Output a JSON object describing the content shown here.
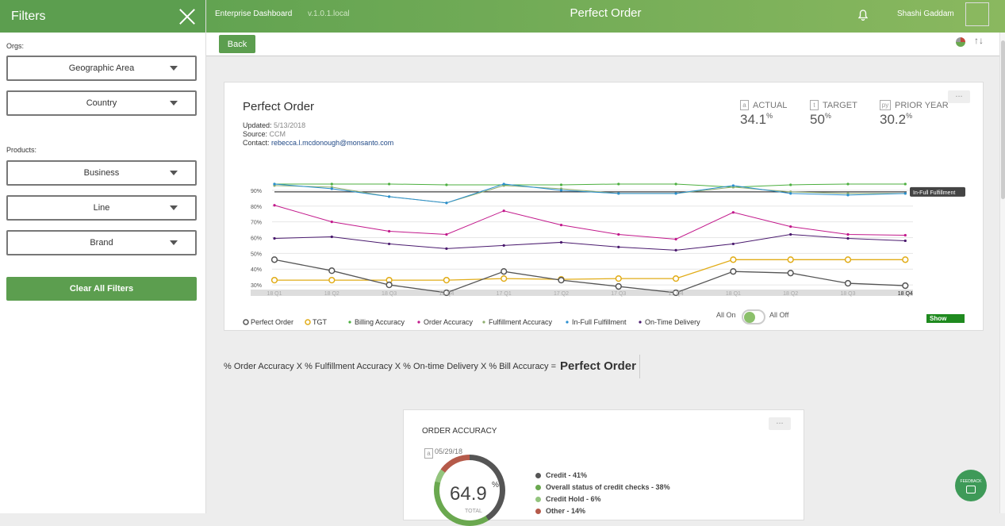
{
  "sidebar": {
    "title": "Filters",
    "orgs_label": "Orgs:",
    "products_label": "Products:",
    "orgs": [
      "Geographic Area",
      "Country"
    ],
    "products": [
      "Business",
      "Line",
      "Brand"
    ],
    "clear_label": "Clear All Filters"
  },
  "topbar": {
    "app_name": "Enterprise Dashboard",
    "version": "v.1.0.1.local",
    "title": "Perfect Order",
    "user": "Shashi Gaddam"
  },
  "subbar": {
    "back_label": "Back",
    "sort_icon": "↑↓"
  },
  "card": {
    "title": "Perfect Order",
    "updated_label": "Updated:",
    "updated": "5/13/2018",
    "source_label": "Source:",
    "source": "CCM",
    "contact_label": "Contact:",
    "contact": "rebecca.l.mcdonough@monsanto.com",
    "more": "...",
    "kpis": [
      {
        "icon": "a",
        "label": "ACTUAL",
        "value": "34.1",
        "unit": "%"
      },
      {
        "icon": "t",
        "label": "TARGET",
        "value": "50",
        "unit": "%"
      },
      {
        "icon": "py",
        "label": "PRIOR YEAR",
        "value": "30.2",
        "unit": "%"
      }
    ],
    "legend": [
      {
        "label": "Perfect Order",
        "symbol": "ring",
        "color": "#555555"
      },
      {
        "label": "TGT",
        "symbol": "ring",
        "color": "#e1ac17"
      },
      {
        "label": "Billing Accuracy",
        "symbol": "dot",
        "color": "#4caf3f"
      },
      {
        "label": "Order Accuracy",
        "symbol": "dot",
        "color": "#c2188b"
      },
      {
        "label": "Fulfillment Accuracy",
        "symbol": "dot",
        "color": "#8fae6f"
      },
      {
        "label": "In-Full Fulfillment",
        "symbol": "dot",
        "color": "#2a8fd0"
      },
      {
        "label": "On-Time Delivery",
        "symbol": "dot",
        "color": "#4a1a6e"
      }
    ],
    "toggle_on": "All On",
    "toggle_off": "All Off",
    "show_values": "Show Values"
  },
  "chart_data": {
    "type": "line",
    "categories": [
      "18 Q1",
      "18 Q2",
      "18 Q3",
      "18 Q4",
      "17 Q1",
      "17 Q2",
      "17 Q3",
      "17 Q4",
      "18 Q1",
      "18 Q2",
      "18 Q3",
      "18 Q4"
    ],
    "y_ticks": [
      "30%",
      "40%",
      "50%",
      "60%",
      "70%",
      "80%",
      "90%"
    ],
    "ylim": [
      25,
      98
    ],
    "reference_line": {
      "value": 89,
      "label": "In-Full Fulfillment"
    },
    "series": [
      {
        "name": "Billing Accuracy",
        "color": "#4caf3f",
        "marker": "dot",
        "values": [
          94,
          94,
          94,
          93.5,
          93.5,
          93.5,
          94,
          94,
          92,
          93.5,
          94,
          94
        ]
      },
      {
        "name": "Fulfillment Accuracy",
        "color": "#8fae6f",
        "marker": "dot",
        "values": [
          93,
          92,
          86,
          82,
          93,
          91,
          88,
          88,
          92,
          89,
          88,
          88
        ]
      },
      {
        "name": "In-Full Fulfillment",
        "color": "#2a8fd0",
        "marker": "dot",
        "values": [
          94,
          91,
          86,
          82,
          94,
          90,
          88,
          88,
          93,
          88,
          87,
          88
        ]
      },
      {
        "name": "Order Accuracy",
        "color": "#c2188b",
        "marker": "dot",
        "values": [
          80.5,
          70,
          64,
          62,
          77,
          68,
          62,
          59,
          76,
          67,
          62,
          61.5
        ]
      },
      {
        "name": "On-Time Delivery",
        "color": "#4a1a6e",
        "marker": "dot",
        "values": [
          59.5,
          60.5,
          56,
          53,
          55,
          57,
          54,
          52,
          56,
          62,
          59.5,
          58
        ]
      },
      {
        "name": "TGT",
        "color": "#e1ac17",
        "marker": "ring",
        "values": [
          33,
          33,
          33,
          33,
          34,
          33.5,
          34,
          34,
          46,
          46,
          46,
          46
        ]
      },
      {
        "name": "Perfect Order",
        "color": "#555555",
        "marker": "ring",
        "values": [
          46,
          39,
          30,
          25,
          38.5,
          33,
          29,
          25,
          38.5,
          37.5,
          31,
          29.5
        ]
      }
    ]
  },
  "formula": {
    "text": "% Order Accuracy X % Fulfillment Accuracy X % On-time Delivery X % Bill Accuracy =",
    "result": "Perfect Order"
  },
  "order_accuracy": {
    "title": "ORDER ACCURACY",
    "icon": "a",
    "date": "05/29/18",
    "more": "...",
    "value": "64.9",
    "unit": "%",
    "total_label": "TOTAL",
    "slices": [
      {
        "label": "Credit - 41%",
        "pct": 41,
        "color": "#555555"
      },
      {
        "label": "Overall status of credit checks - 38%",
        "pct": 38,
        "color": "#6aa84f"
      },
      {
        "label": "Credit Hold - 6%",
        "pct": 6,
        "color": "#93c47d"
      },
      {
        "label": "Other - 14%",
        "pct": 14,
        "color": "#b55a4a"
      }
    ]
  },
  "feedback": {
    "label": "FEEDBACK"
  }
}
